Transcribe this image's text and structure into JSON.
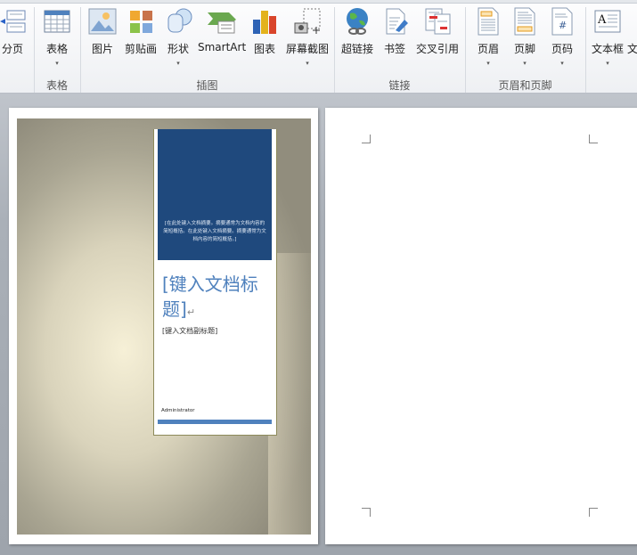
{
  "ribbon": {
    "buttons": {
      "page_break": "分页",
      "table": "表格",
      "picture": "图片",
      "clipart": "剪贴画",
      "shapes": "形状",
      "smartart": "SmartArt",
      "chart": "图表",
      "screenshot": "屏幕截图",
      "hyperlink": "超链接",
      "bookmark": "书签",
      "cross_reference": "交叉引用",
      "header": "页眉",
      "footer": "页脚",
      "page_number": "页码",
      "textbox": "文本框",
      "text_partial": "文"
    },
    "groups": {
      "tables": "表格",
      "illustrations": "插图",
      "links": "链接",
      "header_footer": "页眉和页脚"
    },
    "dropdown_arrow": "▾"
  },
  "document": {
    "cover": {
      "abstract": "[在此处键入文档摘要。摘要通常为文档内容的简短概括。在此处键入文档摘要。摘要通常为文档内容的简短概括。]",
      "title": "[键入文档标题]",
      "subtitle": "[键入文档副标题]",
      "author": "Administrator",
      "paragraph_mark": "↵"
    },
    "colors": {
      "cover_blue": "#1f497d",
      "accent": "#4f81bd"
    }
  }
}
